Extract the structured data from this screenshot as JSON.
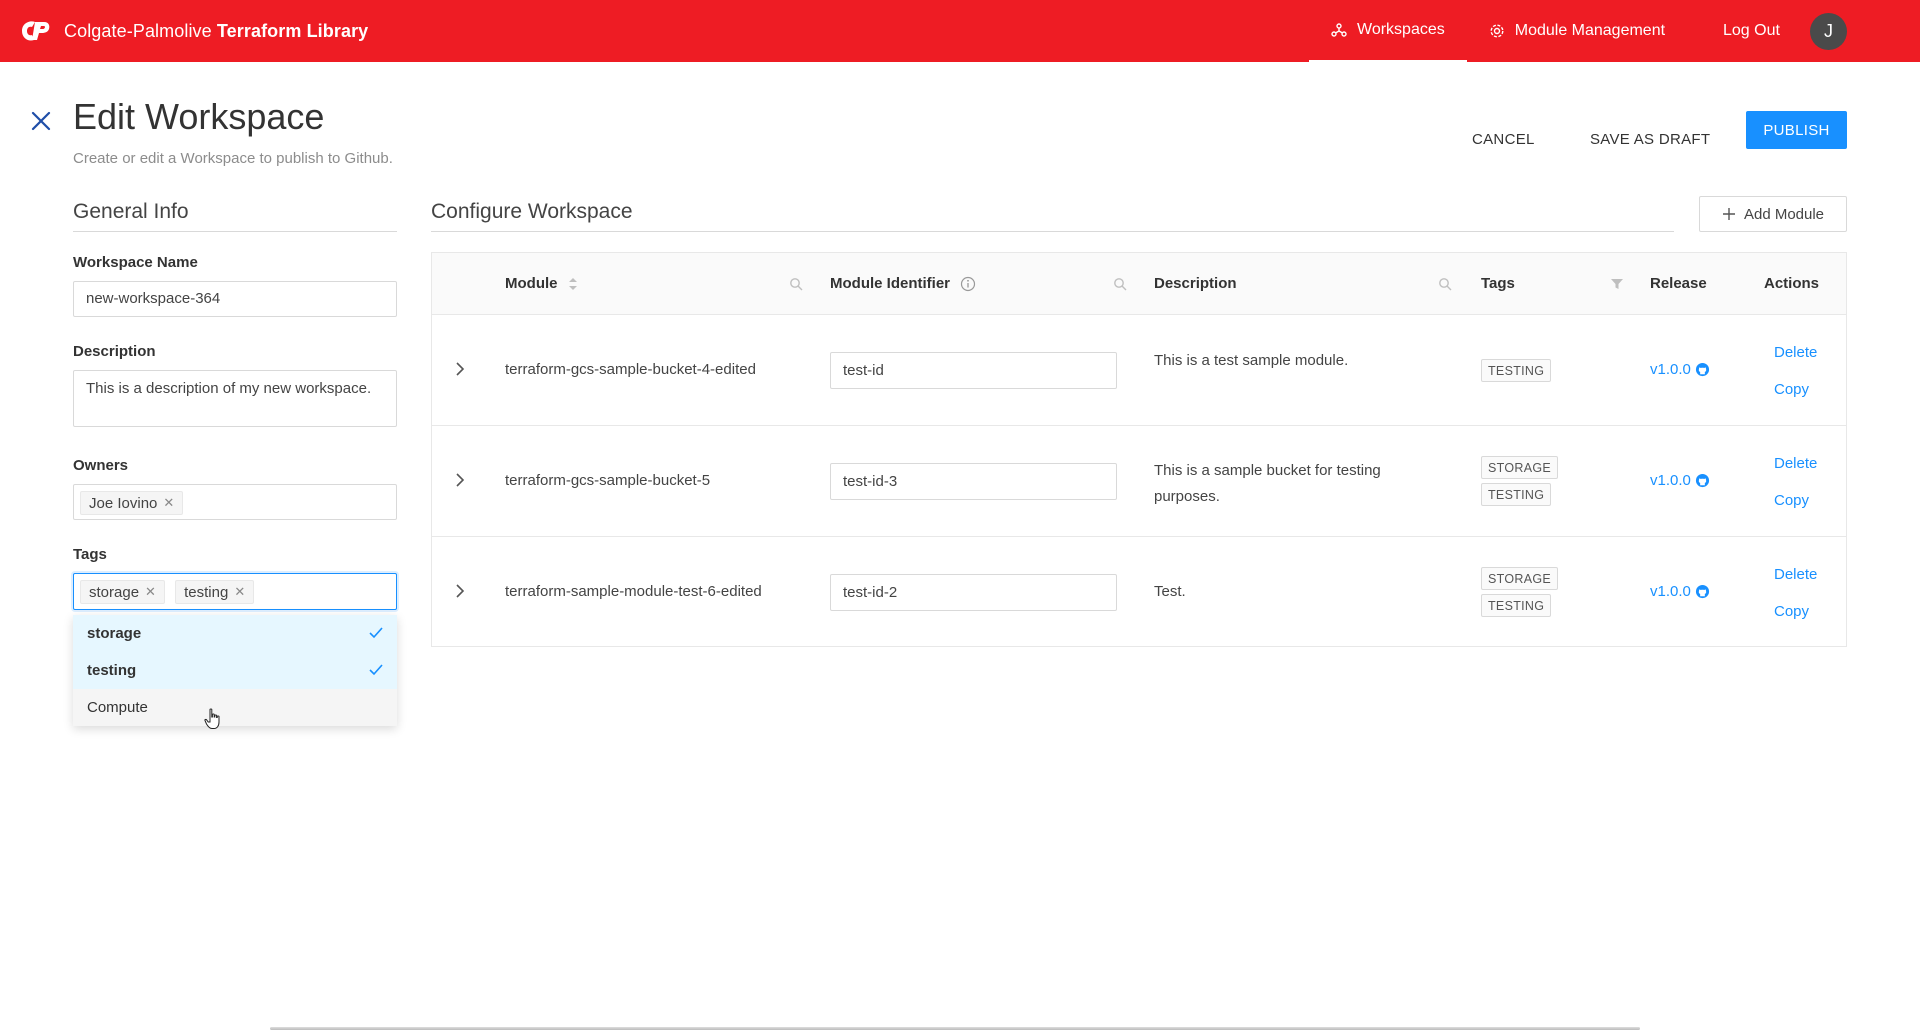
{
  "app": {
    "brand_prefix": "Colgate-Palmolive",
    "brand_name": "Terraform Library",
    "accent": "#ee1c24",
    "primary": "#1890ff"
  },
  "nav": {
    "workspaces": "Workspaces",
    "module_management": "Module Management",
    "logout": "Log Out",
    "avatar_initial": "J"
  },
  "header": {
    "title": "Edit Workspace",
    "subtitle": "Create or edit a Workspace to publish to Github.",
    "cancel": "CANCEL",
    "save_draft": "SAVE AS DRAFT",
    "publish": "PUBLISH"
  },
  "general": {
    "title": "General Info",
    "workspace_name_label": "Workspace Name",
    "workspace_name_value": "new-workspace-364",
    "description_label": "Description",
    "description_value": "This is a description of my new workspace.",
    "owners_label": "Owners",
    "owners": [
      "Joe Iovino"
    ],
    "tags_label": "Tags",
    "tags": [
      "storage",
      "testing"
    ],
    "options": [
      {
        "label": "storage",
        "selected": true
      },
      {
        "label": "testing",
        "selected": true
      },
      {
        "label": "Compute",
        "selected": false
      }
    ]
  },
  "configure": {
    "title": "Configure Workspace",
    "add_module": "Add Module",
    "columns": {
      "module": "Module",
      "identifier": "Module Identifier",
      "description": "Description",
      "tags": "Tags",
      "release": "Release",
      "actions": "Actions"
    },
    "rows": [
      {
        "module": "terraform-gcs-sample-bucket-4-edited",
        "identifier": "test-id",
        "description": "This is a test sample module.",
        "tags": [
          "TESTING"
        ],
        "release": "v1.0.0",
        "delete": "Delete",
        "copy": "Copy"
      },
      {
        "module": "terraform-gcs-sample-bucket-5",
        "identifier": "test-id-3",
        "description": "This is a sample bucket for testing purposes.",
        "tags": [
          "STORAGE",
          "TESTING"
        ],
        "release": "v1.0.0",
        "delete": "Delete",
        "copy": "Copy"
      },
      {
        "module": "terraform-sample-module-test-6-edited",
        "identifier": "test-id-2",
        "description": "Test.",
        "tags": [
          "STORAGE",
          "TESTING"
        ],
        "release": "v1.0.0",
        "delete": "Delete",
        "copy": "Copy"
      }
    ]
  }
}
